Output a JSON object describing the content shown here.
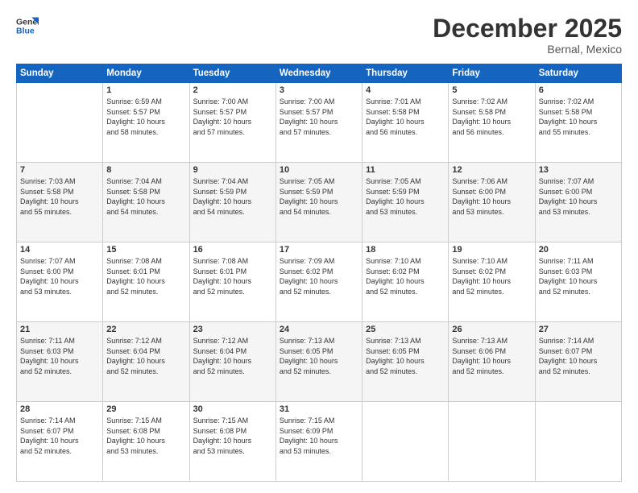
{
  "header": {
    "logo_line1": "General",
    "logo_line2": "Blue",
    "month": "December 2025",
    "location": "Bernal, Mexico"
  },
  "weekdays": [
    "Sunday",
    "Monday",
    "Tuesday",
    "Wednesday",
    "Thursday",
    "Friday",
    "Saturday"
  ],
  "weeks": [
    [
      {
        "day": "",
        "info": ""
      },
      {
        "day": "1",
        "info": "Sunrise: 6:59 AM\nSunset: 5:57 PM\nDaylight: 10 hours\nand 58 minutes."
      },
      {
        "day": "2",
        "info": "Sunrise: 7:00 AM\nSunset: 5:57 PM\nDaylight: 10 hours\nand 57 minutes."
      },
      {
        "day": "3",
        "info": "Sunrise: 7:00 AM\nSunset: 5:57 PM\nDaylight: 10 hours\nand 57 minutes."
      },
      {
        "day": "4",
        "info": "Sunrise: 7:01 AM\nSunset: 5:58 PM\nDaylight: 10 hours\nand 56 minutes."
      },
      {
        "day": "5",
        "info": "Sunrise: 7:02 AM\nSunset: 5:58 PM\nDaylight: 10 hours\nand 56 minutes."
      },
      {
        "day": "6",
        "info": "Sunrise: 7:02 AM\nSunset: 5:58 PM\nDaylight: 10 hours\nand 55 minutes."
      }
    ],
    [
      {
        "day": "7",
        "info": "Sunrise: 7:03 AM\nSunset: 5:58 PM\nDaylight: 10 hours\nand 55 minutes."
      },
      {
        "day": "8",
        "info": "Sunrise: 7:04 AM\nSunset: 5:58 PM\nDaylight: 10 hours\nand 54 minutes."
      },
      {
        "day": "9",
        "info": "Sunrise: 7:04 AM\nSunset: 5:59 PM\nDaylight: 10 hours\nand 54 minutes."
      },
      {
        "day": "10",
        "info": "Sunrise: 7:05 AM\nSunset: 5:59 PM\nDaylight: 10 hours\nand 54 minutes."
      },
      {
        "day": "11",
        "info": "Sunrise: 7:05 AM\nSunset: 5:59 PM\nDaylight: 10 hours\nand 53 minutes."
      },
      {
        "day": "12",
        "info": "Sunrise: 7:06 AM\nSunset: 6:00 PM\nDaylight: 10 hours\nand 53 minutes."
      },
      {
        "day": "13",
        "info": "Sunrise: 7:07 AM\nSunset: 6:00 PM\nDaylight: 10 hours\nand 53 minutes."
      }
    ],
    [
      {
        "day": "14",
        "info": "Sunrise: 7:07 AM\nSunset: 6:00 PM\nDaylight: 10 hours\nand 53 minutes."
      },
      {
        "day": "15",
        "info": "Sunrise: 7:08 AM\nSunset: 6:01 PM\nDaylight: 10 hours\nand 52 minutes."
      },
      {
        "day": "16",
        "info": "Sunrise: 7:08 AM\nSunset: 6:01 PM\nDaylight: 10 hours\nand 52 minutes."
      },
      {
        "day": "17",
        "info": "Sunrise: 7:09 AM\nSunset: 6:02 PM\nDaylight: 10 hours\nand 52 minutes."
      },
      {
        "day": "18",
        "info": "Sunrise: 7:10 AM\nSunset: 6:02 PM\nDaylight: 10 hours\nand 52 minutes."
      },
      {
        "day": "19",
        "info": "Sunrise: 7:10 AM\nSunset: 6:02 PM\nDaylight: 10 hours\nand 52 minutes."
      },
      {
        "day": "20",
        "info": "Sunrise: 7:11 AM\nSunset: 6:03 PM\nDaylight: 10 hours\nand 52 minutes."
      }
    ],
    [
      {
        "day": "21",
        "info": "Sunrise: 7:11 AM\nSunset: 6:03 PM\nDaylight: 10 hours\nand 52 minutes."
      },
      {
        "day": "22",
        "info": "Sunrise: 7:12 AM\nSunset: 6:04 PM\nDaylight: 10 hours\nand 52 minutes."
      },
      {
        "day": "23",
        "info": "Sunrise: 7:12 AM\nSunset: 6:04 PM\nDaylight: 10 hours\nand 52 minutes."
      },
      {
        "day": "24",
        "info": "Sunrise: 7:13 AM\nSunset: 6:05 PM\nDaylight: 10 hours\nand 52 minutes."
      },
      {
        "day": "25",
        "info": "Sunrise: 7:13 AM\nSunset: 6:05 PM\nDaylight: 10 hours\nand 52 minutes."
      },
      {
        "day": "26",
        "info": "Sunrise: 7:13 AM\nSunset: 6:06 PM\nDaylight: 10 hours\nand 52 minutes."
      },
      {
        "day": "27",
        "info": "Sunrise: 7:14 AM\nSunset: 6:07 PM\nDaylight: 10 hours\nand 52 minutes."
      }
    ],
    [
      {
        "day": "28",
        "info": "Sunrise: 7:14 AM\nSunset: 6:07 PM\nDaylight: 10 hours\nand 52 minutes."
      },
      {
        "day": "29",
        "info": "Sunrise: 7:15 AM\nSunset: 6:08 PM\nDaylight: 10 hours\nand 53 minutes."
      },
      {
        "day": "30",
        "info": "Sunrise: 7:15 AM\nSunset: 6:08 PM\nDaylight: 10 hours\nand 53 minutes."
      },
      {
        "day": "31",
        "info": "Sunrise: 7:15 AM\nSunset: 6:09 PM\nDaylight: 10 hours\nand 53 minutes."
      },
      {
        "day": "",
        "info": ""
      },
      {
        "day": "",
        "info": ""
      },
      {
        "day": "",
        "info": ""
      }
    ]
  ]
}
